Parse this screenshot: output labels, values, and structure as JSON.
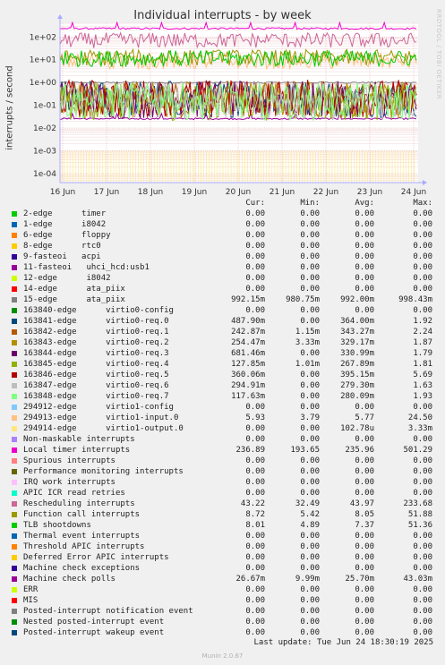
{
  "title": "Individual interrupts - by week",
  "side_credit": "RRDTOOL / TOBI OETIKER",
  "footer": {
    "last_update": "Last update: Tue Jun 24 18:30:19 2025",
    "version": "Munin 2.0.67"
  },
  "legend_headers": [
    "Cur:",
    "Min:",
    "Avg:",
    "Max:"
  ],
  "chart_data": {
    "type": "line",
    "title": "Individual interrupts - by week",
    "ylabel": "interrupts / second",
    "y_scale": "log",
    "ylim": [
      4e-05,
      400
    ],
    "y_ticks": [
      {
        "label": "1e-04",
        "value": 0.0001
      },
      {
        "label": "1e-03",
        "value": 0.001
      },
      {
        "label": "1e-02",
        "value": 0.01
      },
      {
        "label": "1e-01",
        "value": 0.1
      },
      {
        "label": "1e+00",
        "value": 1
      },
      {
        "label": "1e+01",
        "value": 10
      },
      {
        "label": "1e+02",
        "value": 100
      }
    ],
    "x_ticks": [
      "16 Jun",
      "17 Jun",
      "18 Jun",
      "19 Jun",
      "20 Jun",
      "21 Jun",
      "22 Jun",
      "23 Jun",
      "24 Jun"
    ],
    "grid": true,
    "legend_position": "bottom",
    "series": [
      {
        "name": "2-edge      timer",
        "color": "#00cc00",
        "cur": "0.00",
        "min": "0.00",
        "avg": "0.00",
        "max": "0.00"
      },
      {
        "name": "1-edge      i8042",
        "color": "#0066b3",
        "cur": "0.00",
        "min": "0.00",
        "avg": "0.00",
        "max": "0.00"
      },
      {
        "name": "6-edge      floppy",
        "color": "#ff8000",
        "cur": "0.00",
        "min": "0.00",
        "avg": "0.00",
        "max": "0.00"
      },
      {
        "name": "8-edge      rtc0",
        "color": "#ffcc00",
        "cur": "0.00",
        "min": "0.00",
        "avg": "0.00",
        "max": "0.00"
      },
      {
        "name": "9-fasteoi   acpi",
        "color": "#330099",
        "cur": "0.00",
        "min": "0.00",
        "avg": "0.00",
        "max": "0.00"
      },
      {
        "name": "11-fasteoi   uhci_hcd:usb1",
        "color": "#990099",
        "cur": "0.00",
        "min": "0.00",
        "avg": "0.00",
        "max": "0.00"
      },
      {
        "name": "12-edge      i8042",
        "color": "#ccff00",
        "cur": "0.00",
        "min": "0.00",
        "avg": "0.00",
        "max": "0.00"
      },
      {
        "name": "14-edge      ata_piix",
        "color": "#ff0000",
        "cur": "0.00",
        "min": "0.00",
        "avg": "0.00",
        "max": "0.00"
      },
      {
        "name": "15-edge      ata_piix",
        "color": "#808080",
        "cur": "992.15m",
        "min": "980.75m",
        "avg": "992.00m",
        "max": "998.43m"
      },
      {
        "name": "163840-edge      virtio0-config",
        "color": "#008f00",
        "cur": "0.00",
        "min": "0.00",
        "avg": "0.00",
        "max": "0.00"
      },
      {
        "name": "163841-edge      virtio0-req.0",
        "color": "#00487d",
        "cur": "487.90m",
        "min": "0.00",
        "avg": "364.00m",
        "max": "1.92"
      },
      {
        "name": "163842-edge      virtio0-req.1",
        "color": "#b35a00",
        "cur": "242.87m",
        "min": "1.15m",
        "avg": "343.27m",
        "max": "2.24"
      },
      {
        "name": "163843-edge      virtio0-req.2",
        "color": "#b38f00",
        "cur": "254.47m",
        "min": "3.33m",
        "avg": "329.17m",
        "max": "1.87"
      },
      {
        "name": "163844-edge      virtio0-req.3",
        "color": "#6b006b",
        "cur": "681.46m",
        "min": "0.00",
        "avg": "330.99m",
        "max": "1.79"
      },
      {
        "name": "163845-edge      virtio0-req.4",
        "color": "#8fb300",
        "cur": "127.85m",
        "min": "1.01m",
        "avg": "267.89m",
        "max": "1.81"
      },
      {
        "name": "163846-edge      virtio0-req.5",
        "color": "#b30000",
        "cur": "360.06m",
        "min": "0.00",
        "avg": "395.15m",
        "max": "5.69"
      },
      {
        "name": "163847-edge      virtio0-req.6",
        "color": "#bebebe",
        "cur": "294.91m",
        "min": "0.00",
        "avg": "279.30m",
        "max": "1.63"
      },
      {
        "name": "163848-edge      virtio0-req.7",
        "color": "#80ff80",
        "cur": "117.63m",
        "min": "0.00",
        "avg": "280.09m",
        "max": "1.93"
      },
      {
        "name": "294912-edge      virtio1-config",
        "color": "#80c9ff",
        "cur": "0.00",
        "min": "0.00",
        "avg": "0.00",
        "max": "0.00"
      },
      {
        "name": "294913-edge      virtio1-input.0",
        "color": "#ffc080",
        "cur": "5.93",
        "min": "3.79",
        "avg": "5.77",
        "max": "24.50"
      },
      {
        "name": "294914-edge      virtio1-output.0",
        "color": "#ffe680",
        "cur": "0.00",
        "min": "0.00",
        "avg": "102.78u",
        "max": "3.33m"
      },
      {
        "name": "Non-maskable interrupts",
        "color": "#aa80ff",
        "cur": "0.00",
        "min": "0.00",
        "avg": "0.00",
        "max": "0.00"
      },
      {
        "name": "Local timer interrupts",
        "color": "#ee00cc",
        "cur": "236.89",
        "min": "193.65",
        "avg": "235.96",
        "max": "501.29"
      },
      {
        "name": "Spurious interrupts",
        "color": "#ff8080",
        "cur": "0.00",
        "min": "0.00",
        "avg": "0.00",
        "max": "0.00"
      },
      {
        "name": "Performance monitoring interrupts",
        "color": "#666600",
        "cur": "0.00",
        "min": "0.00",
        "avg": "0.00",
        "max": "0.00"
      },
      {
        "name": "IRQ work interrupts",
        "color": "#ffbfff",
        "cur": "0.00",
        "min": "0.00",
        "avg": "0.00",
        "max": "0.00"
      },
      {
        "name": "APIC ICR read retries",
        "color": "#00ffcc",
        "cur": "0.00",
        "min": "0.00",
        "avg": "0.00",
        "max": "0.00"
      },
      {
        "name": "Rescheduling interrupts",
        "color": "#cc6699",
        "cur": "43.22",
        "min": "32.49",
        "avg": "43.97",
        "max": "233.68"
      },
      {
        "name": "Function call interrupts",
        "color": "#999900",
        "cur": "8.72",
        "min": "5.42",
        "avg": "8.05",
        "max": "51.88"
      },
      {
        "name": "TLB shootdowns",
        "color": "#00cc00",
        "cur": "8.01",
        "min": "4.89",
        "avg": "7.37",
        "max": "51.36"
      },
      {
        "name": "Thermal event interrupts",
        "color": "#0066b3",
        "cur": "0.00",
        "min": "0.00",
        "avg": "0.00",
        "max": "0.00"
      },
      {
        "name": "Threshold APIC interrupts",
        "color": "#ff8000",
        "cur": "0.00",
        "min": "0.00",
        "avg": "0.00",
        "max": "0.00"
      },
      {
        "name": "Deferred Error APIC interrupts",
        "color": "#ffcc00",
        "cur": "0.00",
        "min": "0.00",
        "avg": "0.00",
        "max": "0.00"
      },
      {
        "name": "Machine check exceptions",
        "color": "#330099",
        "cur": "0.00",
        "min": "0.00",
        "avg": "0.00",
        "max": "0.00"
      },
      {
        "name": "Machine check polls",
        "color": "#990099",
        "cur": "26.67m",
        "min": "9.99m",
        "avg": "25.70m",
        "max": "43.03m"
      },
      {
        "name": "ERR",
        "color": "#ccff00",
        "cur": "0.00",
        "min": "0.00",
        "avg": "0.00",
        "max": "0.00"
      },
      {
        "name": "MIS",
        "color": "#ff0000",
        "cur": "0.00",
        "min": "0.00",
        "avg": "0.00",
        "max": "0.00"
      },
      {
        "name": "Posted-interrupt notification event",
        "color": "#808080",
        "cur": "0.00",
        "min": "0.00",
        "avg": "0.00",
        "max": "0.00"
      },
      {
        "name": "Nested posted-interrupt event",
        "color": "#008f00",
        "cur": "0.00",
        "min": "0.00",
        "avg": "0.00",
        "max": "0.00"
      },
      {
        "name": "Posted-interrupt wakeup event",
        "color": "#00487d",
        "cur": "0.00",
        "min": "0.00",
        "avg": "0.00",
        "max": "0.00"
      }
    ]
  }
}
